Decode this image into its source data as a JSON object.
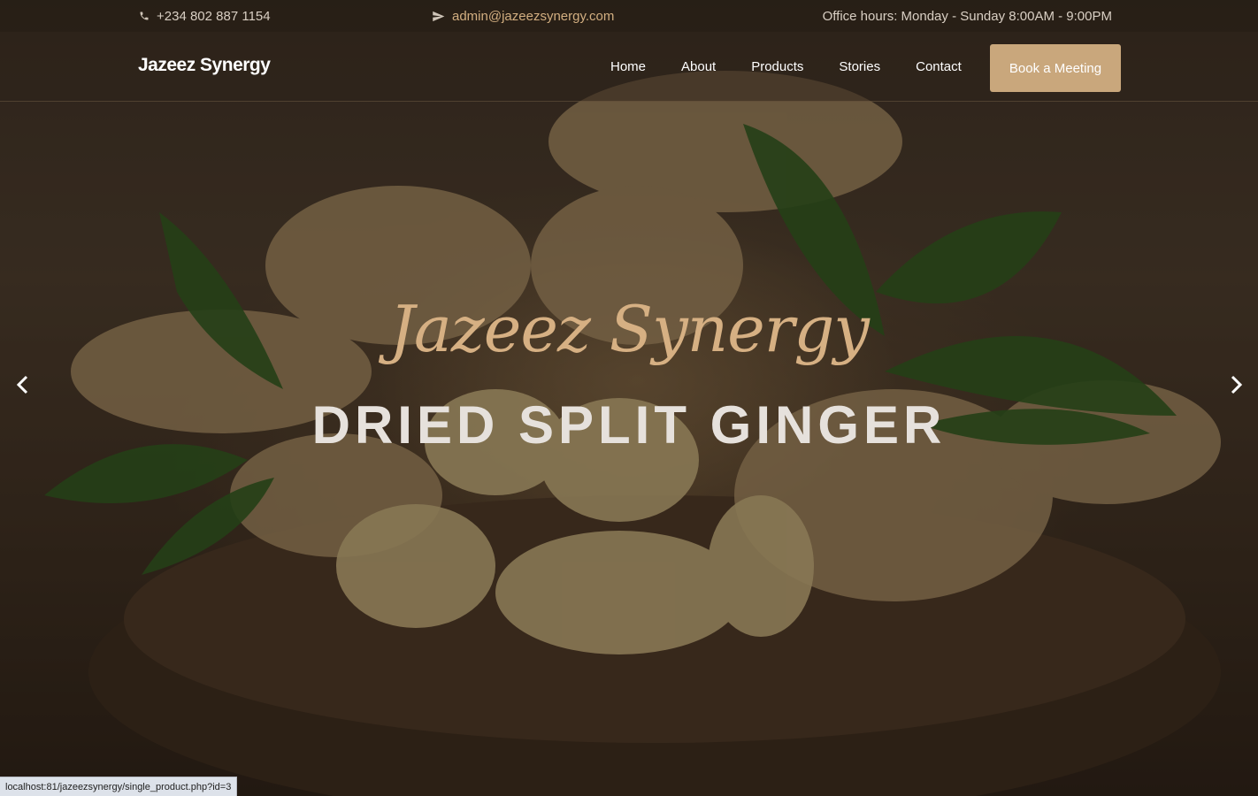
{
  "topbar": {
    "phone": "+234 802 887 1154",
    "email": "admin@jazeezsynergy.com",
    "hours": "Office hours: Monday - Sunday 8:00AM - 9:00PM",
    "phone_icon": "phone-icon",
    "email_icon": "paper-plane-icon"
  },
  "navbar": {
    "brand": "Jazeez Synergy",
    "links": [
      "Home",
      "About",
      "Products",
      "Stories",
      "Contact"
    ],
    "cta": "Book a Meeting"
  },
  "hero": {
    "script_title": "Jazeez Synergy",
    "title": "DRIED SPLIT GINGER",
    "prev_icon": "chevron-left-icon",
    "next_icon": "chevron-right-icon"
  },
  "status_url": "localhost:81/jazeezsynergy/single_product.php?id=3",
  "colors": {
    "accent": "#c9a77c",
    "script": "#d6b083"
  }
}
